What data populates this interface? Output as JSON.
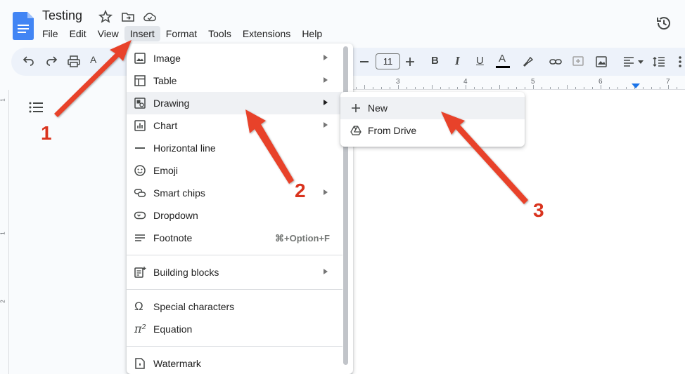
{
  "app": {
    "doc_title": "Testing",
    "icons": [
      "docs-logo-icon",
      "star-icon",
      "move-to-folder-icon",
      "cloud-saved-icon",
      "version-history-icon"
    ]
  },
  "menubar": {
    "items": [
      "File",
      "Edit",
      "View",
      "Insert",
      "Format",
      "Tools",
      "Extensions",
      "Help"
    ],
    "active": "Insert"
  },
  "toolbar": {
    "font_size": "11",
    "bold": "B",
    "italic": "I",
    "underline": "U",
    "text_color_bar": "#000000"
  },
  "ruler": {
    "top_labels": [
      "3",
      "4",
      "5",
      "6",
      "7"
    ],
    "left_labels": [
      "1",
      "1",
      "2"
    ]
  },
  "insert_menu": {
    "items": [
      {
        "label": "Image",
        "icon": "image-icon",
        "has_submenu": true
      },
      {
        "label": "Table",
        "icon": "table-icon",
        "has_submenu": true
      },
      {
        "label": "Drawing",
        "icon": "drawing-icon",
        "has_submenu": true,
        "highlighted": true
      },
      {
        "label": "Chart",
        "icon": "chart-icon",
        "has_submenu": true
      },
      {
        "label": "Horizontal line",
        "icon": "horizontal-line-icon",
        "has_submenu": false
      },
      {
        "label": "Emoji",
        "icon": "emoji-icon",
        "has_submenu": false
      },
      {
        "label": "Smart chips",
        "icon": "smart-chips-icon",
        "has_submenu": true
      },
      {
        "label": "Dropdown",
        "icon": "dropdown-icon",
        "has_submenu": false
      },
      {
        "label": "Footnote",
        "icon": "footnote-icon",
        "has_submenu": false,
        "shortcut": "⌘+Option+F"
      },
      {
        "label": "Building blocks",
        "icon": "building-blocks-icon",
        "has_submenu": true
      },
      {
        "label": "Special characters",
        "icon": "omega-icon",
        "has_submenu": false
      },
      {
        "label": "Equation",
        "icon": "pi-icon",
        "has_submenu": false
      },
      {
        "label": "Watermark",
        "icon": "watermark-icon",
        "has_submenu": false
      }
    ]
  },
  "drawing_submenu": {
    "items": [
      {
        "label": "New",
        "icon": "plus-icon",
        "highlighted": true
      },
      {
        "label": "From Drive",
        "icon": "google-drive-icon"
      }
    ]
  },
  "annotations": {
    "step_labels": [
      "1",
      "2",
      "3"
    ],
    "arrow_color": "#e8432b"
  },
  "colors": {
    "accent": "#1a73e8",
    "docs_blue": "#4285f4",
    "menu_hover": "#eff1f4",
    "toolbar_bg": "#edf2fa"
  }
}
